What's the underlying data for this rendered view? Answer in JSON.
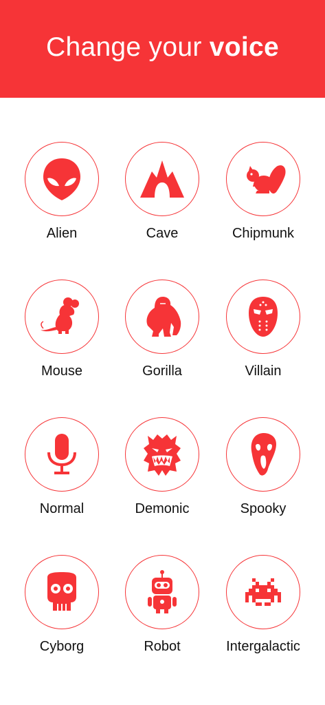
{
  "header": {
    "title_prefix": "Change your ",
    "title_bold": "voice"
  },
  "colors": {
    "accent": "#f63437",
    "text": "#111111",
    "background": "#ffffff"
  },
  "voices": [
    {
      "label": "Alien",
      "icon": "alien-icon"
    },
    {
      "label": "Cave",
      "icon": "cave-icon"
    },
    {
      "label": "Chipmunk",
      "icon": "chipmunk-icon"
    },
    {
      "label": "Mouse",
      "icon": "mouse-icon"
    },
    {
      "label": "Gorilla",
      "icon": "gorilla-icon"
    },
    {
      "label": "Villain",
      "icon": "hockey-mask-icon"
    },
    {
      "label": "Normal",
      "icon": "microphone-icon"
    },
    {
      "label": "Demonic",
      "icon": "demon-icon"
    },
    {
      "label": "Spooky",
      "icon": "scream-mask-icon"
    },
    {
      "label": "Cyborg",
      "icon": "skull-icon"
    },
    {
      "label": "Robot",
      "icon": "robot-icon"
    },
    {
      "label": "Intergalactic",
      "icon": "space-invader-icon"
    }
  ]
}
